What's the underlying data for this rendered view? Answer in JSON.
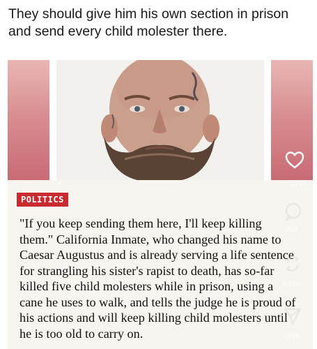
{
  "post": {
    "caption": "They should give him his own section in prison and send every child molester there."
  },
  "photo": {
    "tag_label": "POLITICS",
    "view_count": "179K"
  },
  "article": {
    "text": "\"If you keep sending them here, I'll keep killing them.\" California Inmate, who changed his name to Caesar Augustus and is already serving a life sentence for strangling his sister's rapist to death, has so-far killed five child molesters while in prison, using a cane he uses to walk, and tells the judge he is proud of his actions and will keep killing child molesters until he is too old to carry on."
  },
  "actions": {
    "comment_count": "417",
    "repost_count": "6,226",
    "share_count": "3,715"
  },
  "icons": {
    "like": "heart-icon",
    "comment": "comment-icon",
    "repost": "repost-icon",
    "share": "share-icon"
  },
  "colors": {
    "tag_background": "#c92a2f",
    "card_background": "#f8f5f0"
  }
}
